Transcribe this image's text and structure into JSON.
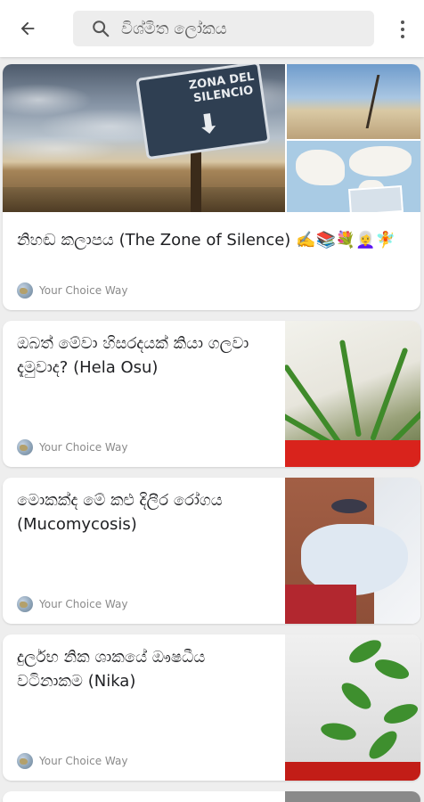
{
  "search": {
    "query": "විශ්මිත ලෝකය"
  },
  "hero": {
    "sign_text": "ZONA DEL SILENCIO"
  },
  "articles": [
    {
      "title": "නිහඬ කලාපය (The Zone of Silence) ✍️📚💐👩‍🦳🧚",
      "source": "Your Choice Way"
    },
    {
      "title": "ඔබත් මේවා හිසරදයක් කියා ගලවා දැමුවාද? (Hela Osu)",
      "source": "Your Choice Way"
    },
    {
      "title": "මොකක්ද මේ කළු දිලීර රෝගය (Mucomycosis)",
      "source": "Your Choice Way"
    },
    {
      "title": "දුර්ලභ නික ශාකයේ ඖෂධීය වටිනාකම (Nika)",
      "source": "Your Choice Way"
    }
  ]
}
